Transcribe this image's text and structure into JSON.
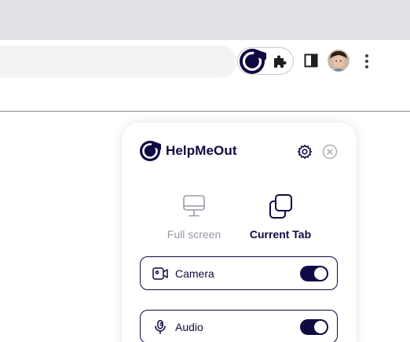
{
  "browser": {
    "toolbar_icons": [
      "helpmeout-extension-icon",
      "puzzle-icon",
      "side-panel-icon",
      "avatar",
      "kebab-menu-icon"
    ]
  },
  "popup": {
    "brand_name": "HelpMeOut",
    "header_icons": [
      "gear-icon",
      "close-icon"
    ],
    "modes": [
      {
        "label": "Full screen",
        "icon": "monitor-icon",
        "selected": false
      },
      {
        "label": "Current Tab",
        "icon": "copy-tab-icon",
        "selected": true
      }
    ],
    "options": [
      {
        "label": "Camera",
        "icon": "video-camera-icon",
        "enabled": true
      },
      {
        "label": "Audio",
        "icon": "microphone-icon",
        "enabled": true
      }
    ],
    "colors": {
      "brand": "#100a42",
      "muted": "#9a98a6",
      "tab_strip": "#dfe1e5",
      "omnibox": "#f1f3f4"
    }
  }
}
